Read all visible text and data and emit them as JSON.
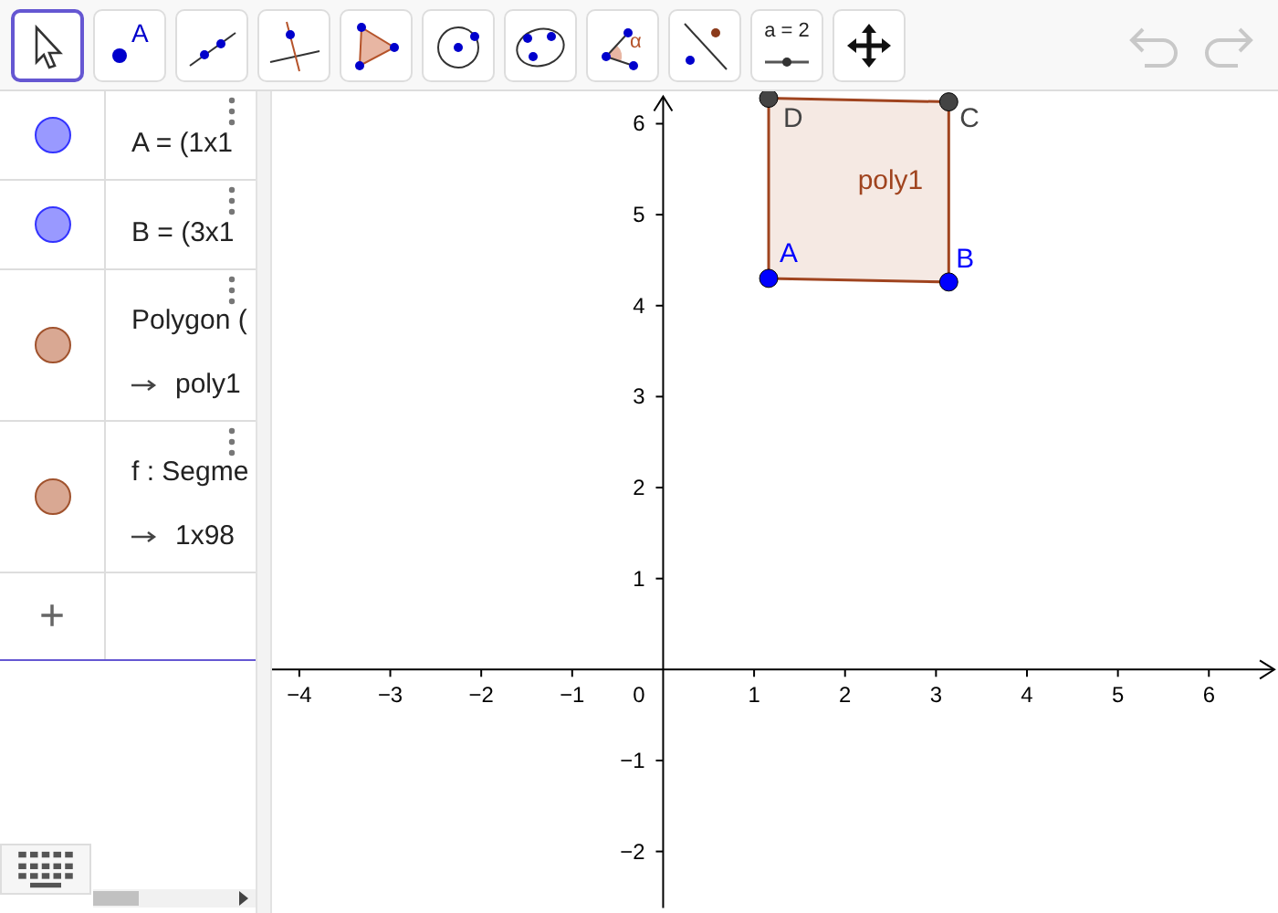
{
  "toolbar": {
    "tools": [
      {
        "kind": "move",
        "selected": true
      },
      {
        "kind": "point",
        "label": "A",
        "selected": false
      },
      {
        "kind": "line",
        "selected": false
      },
      {
        "kind": "perpendicular",
        "selected": false
      },
      {
        "kind": "polygon",
        "selected": false
      },
      {
        "kind": "circle",
        "selected": false
      },
      {
        "kind": "conic",
        "selected": false
      },
      {
        "kind": "angle",
        "label": "α",
        "selected": false
      },
      {
        "kind": "reflect",
        "selected": false
      },
      {
        "kind": "slider",
        "label": "a = 2",
        "selected": false
      },
      {
        "kind": "pan",
        "selected": false
      }
    ],
    "undo_disabled": true,
    "redo_disabled": true
  },
  "algebra": {
    "items": [
      {
        "kind": "point",
        "text": "A = (1x1",
        "color": "#9999ff"
      },
      {
        "kind": "point",
        "text": "B = (3x1",
        "color": "#9999ff"
      },
      {
        "kind": "polygon",
        "text": "Polygon (",
        "output": "poly1",
        "color": "#d9a893"
      },
      {
        "kind": "segment",
        "text": "f : Segme",
        "output": "1x98",
        "color": "#d9a893"
      }
    ],
    "add_symbol": "+"
  },
  "graphics": {
    "x_ticks": [
      "−4",
      "−3",
      "−2",
      "−1",
      "1",
      "2",
      "3",
      "4",
      "5",
      "6"
    ],
    "y_ticks": [
      "6",
      "5",
      "4",
      "3",
      "2",
      "1",
      "−1",
      "−2"
    ],
    "origin": "0",
    "points": [
      {
        "label": "D",
        "color": "#444444"
      },
      {
        "label": "C",
        "color": "#444444"
      },
      {
        "label": "A",
        "color": "#0000ff"
      },
      {
        "label": "B",
        "color": "#0000ff"
      }
    ],
    "polygon_label": "poly1"
  }
}
